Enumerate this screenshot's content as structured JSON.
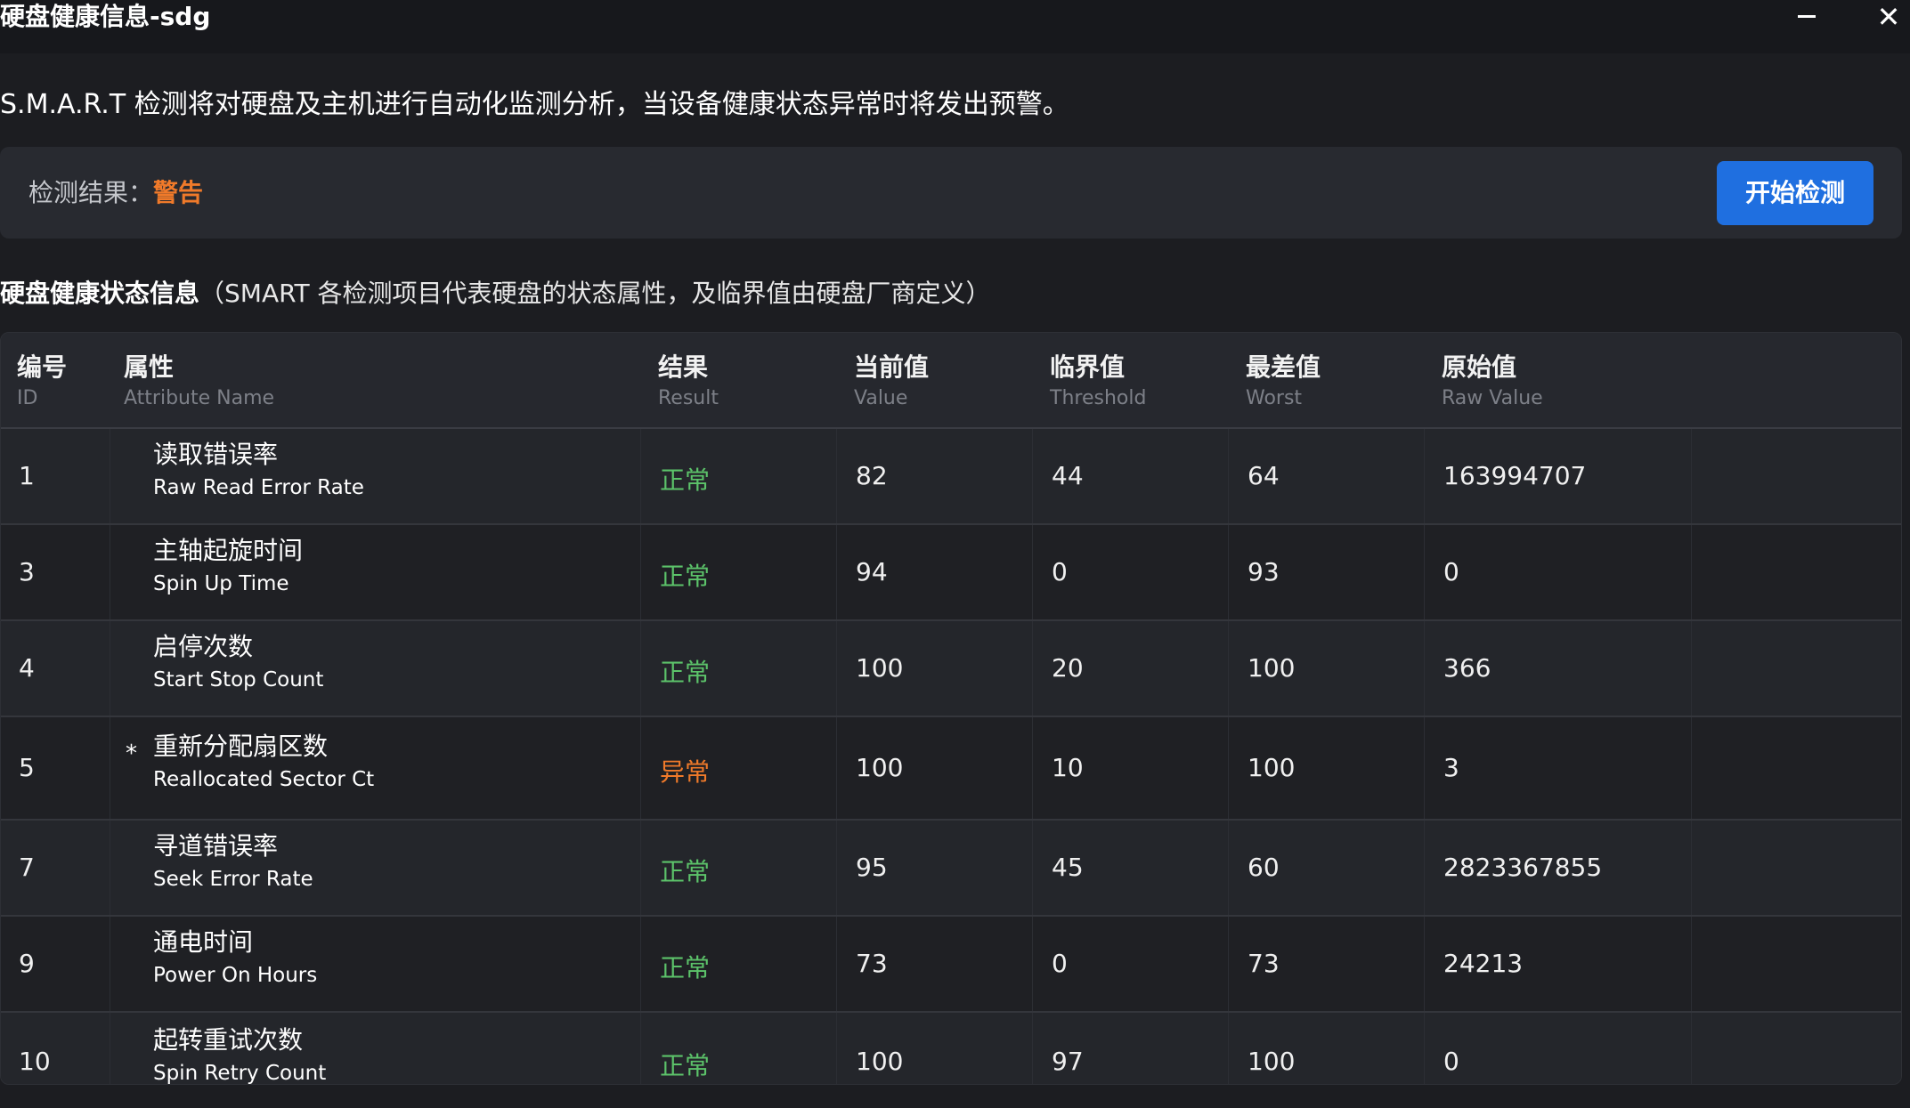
{
  "window": {
    "title": "硬盘健康信息-sdg",
    "minimize_icon": "minimize-icon",
    "close_icon": "close-icon",
    "close_glyph": "✕"
  },
  "intro": "S.M.A.R.T 检测将对硬盘及主机进行自动化监测分析，当设备健康状态异常时将发出预警。",
  "result": {
    "label": "检测结果：",
    "value": "警告",
    "value_color": "#f07a2a",
    "button_label": "开始检测",
    "button_color": "#1f6fe0"
  },
  "section": {
    "title": "硬盘健康状态信息",
    "note": "（SMART 各检测项目代表硬盘的状态属性，及临界值由硬盘厂商定义）"
  },
  "table": {
    "columns": [
      {
        "zh": "编号",
        "en": "ID"
      },
      {
        "zh": "属性",
        "en": "Attribute Name"
      },
      {
        "zh": "结果",
        "en": "Result"
      },
      {
        "zh": "当前值",
        "en": "Value"
      },
      {
        "zh": "临界值",
        "en": "Threshold"
      },
      {
        "zh": "最差值",
        "en": "Worst"
      },
      {
        "zh": "原始值",
        "en": "Raw Value"
      }
    ],
    "status_colors": {
      "ok": "#5cc36a",
      "bad": "#f07a2a"
    },
    "rows": [
      {
        "id": "1",
        "flag": "",
        "name_zh": "读取错误率",
        "name_en": "Raw Read Error Rate",
        "result": "正常",
        "status": "ok",
        "value": "82",
        "threshold": "44",
        "worst": "64",
        "raw": "163994707"
      },
      {
        "id": "3",
        "flag": "",
        "name_zh": "主轴起旋时间",
        "name_en": "Spin Up Time",
        "result": "正常",
        "status": "ok",
        "value": "94",
        "threshold": "0",
        "worst": "93",
        "raw": "0"
      },
      {
        "id": "4",
        "flag": "",
        "name_zh": "启停次数",
        "name_en": "Start Stop Count",
        "result": "正常",
        "status": "ok",
        "value": "100",
        "threshold": "20",
        "worst": "100",
        "raw": "366"
      },
      {
        "id": "5",
        "flag": "*",
        "name_zh": "重新分配扇区数",
        "name_en": "Reallocated Sector Ct",
        "result": "异常",
        "status": "bad",
        "value": "100",
        "threshold": "10",
        "worst": "100",
        "raw": "3"
      },
      {
        "id": "7",
        "flag": "",
        "name_zh": "寻道错误率",
        "name_en": "Seek Error Rate",
        "result": "正常",
        "status": "ok",
        "value": "95",
        "threshold": "45",
        "worst": "60",
        "raw": "2823367855"
      },
      {
        "id": "9",
        "flag": "",
        "name_zh": "通电时间",
        "name_en": "Power On Hours",
        "result": "正常",
        "status": "ok",
        "value": "73",
        "threshold": "0",
        "worst": "73",
        "raw": "24213"
      },
      {
        "id": "10",
        "flag": "",
        "name_zh": "起转重试次数",
        "name_en": "Spin Retry Count",
        "result": "正常",
        "status": "ok",
        "value": "100",
        "threshold": "97",
        "worst": "100",
        "raw": "0"
      }
    ]
  }
}
